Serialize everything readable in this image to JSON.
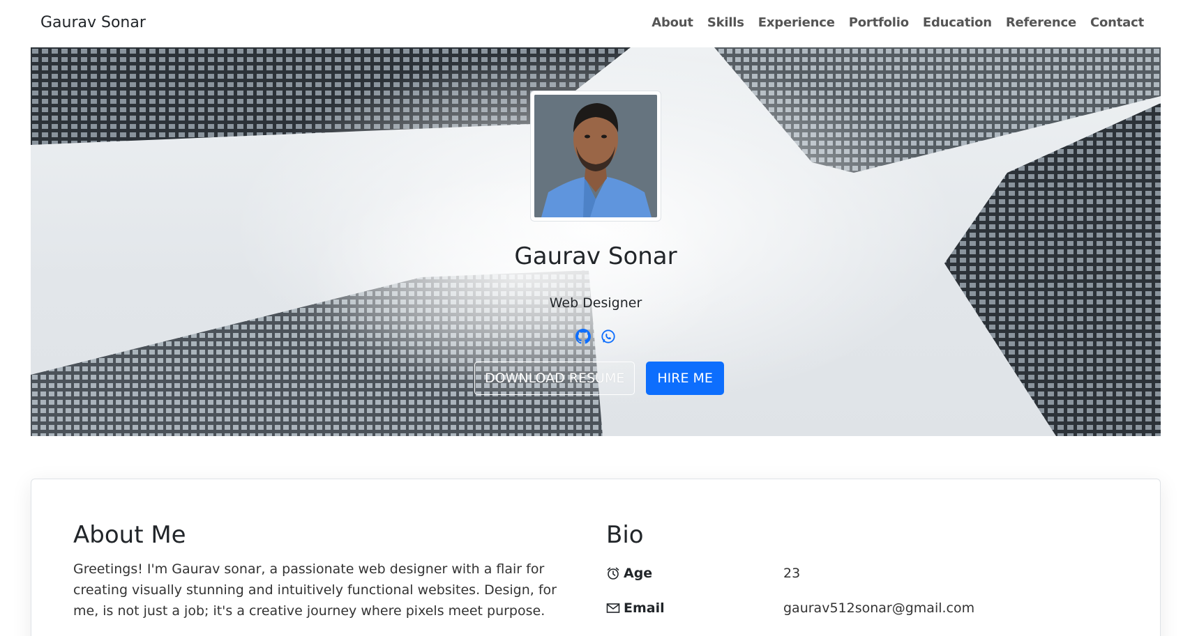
{
  "navbar": {
    "brand": "Gaurav Sonar",
    "links": [
      "About",
      "Skills",
      "Experience",
      "Portfolio",
      "Education",
      "Reference",
      "Contact"
    ]
  },
  "hero": {
    "name": "Gaurav Sonar",
    "role": "Web Designer",
    "social_icons": [
      "github-icon",
      "whatsapp-icon"
    ],
    "download_label": "DOWNLOAD RESUME",
    "hire_label": "HIRE ME"
  },
  "about": {
    "title": "About Me",
    "text": "Greetings! I'm Gaurav sonar, a passionate web designer with a flair for creating visually stunning and intuitively functional websites. Design, for me, is not just a job; it's a creative journey where pixels meet purpose."
  },
  "bio": {
    "title": "Bio",
    "rows": [
      {
        "icon": "alarm-clock-icon",
        "label": "Age",
        "value": "23"
      },
      {
        "icon": "envelope-icon",
        "label": "Email",
        "value": "gaurav512sonar@gmail.com"
      }
    ]
  },
  "colors": {
    "primary": "#0d6efd",
    "social_icon": "#0d6efd",
    "text": "#212529"
  }
}
